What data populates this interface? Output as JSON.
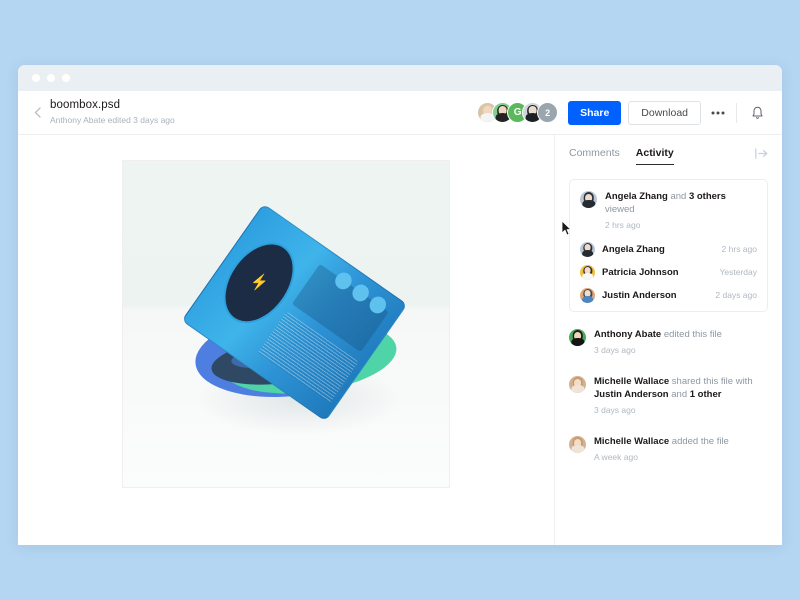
{
  "window": {
    "dots": [
      "close",
      "minimize",
      "maximize"
    ]
  },
  "header": {
    "back_icon": "chevron-left-icon",
    "file_name": "boombox.psd",
    "file_subtitle": "Anthony Abate edited 3 days ago",
    "share_label": "Share",
    "download_label": "Download",
    "more_label": "•••",
    "bell_icon": "bell-icon",
    "avatars": [
      {
        "name": "Avatar 1",
        "type": "photo",
        "bg": "#d8c3a8",
        "hair": "#e3cda6",
        "skin": "#f0d7bd"
      },
      {
        "name": "Avatar 2",
        "type": "photo",
        "bg": "#7fcf8f",
        "hair": "#2a2a2a",
        "skin": "#f0d7bd"
      },
      {
        "name": "Avatar 3",
        "type": "initial",
        "initial": "G",
        "bg": "#5cb85c"
      },
      {
        "name": "Avatar 4",
        "type": "photo",
        "bg": "#cfd6dc",
        "hair": "#20242b",
        "skin": "#eddcc9"
      },
      {
        "name": "Overflow",
        "type": "count",
        "count": "2",
        "bg": "#9aa5ad"
      }
    ]
  },
  "preview": {
    "alt": "boombox.psd preview",
    "artwork": {
      "description": "Translucent blue boombox on blue and teal swirl base",
      "bolt": "⚡"
    }
  },
  "sidebar": {
    "tabs": [
      {
        "label": "Comments",
        "active": false
      },
      {
        "label": "Activity",
        "active": true
      }
    ],
    "collapse_icon": "collapse-panel-icon",
    "viewed_card": {
      "actor": "Angela Zhang",
      "conjunction": "and",
      "others": "3 others",
      "action": "viewed",
      "time": "2 hrs ago",
      "viewers": [
        {
          "name": "Angela Zhang",
          "time": "2 hrs ago",
          "bg": "#b9c6d4",
          "hair": "#2c2f36",
          "skin": "#eddcc9"
        },
        {
          "name": "Patricia Johnson",
          "time": "Yesterday",
          "bg": "#f2c03c",
          "hair": "#2c2f36",
          "skin": "#f3ddc4"
        },
        {
          "name": "Justin Anderson",
          "time": "2 days ago",
          "bg": "#e0a679",
          "hair": "#3c4654",
          "skin": "#f3ddc4"
        }
      ]
    },
    "feed": [
      {
        "actor": "Anthony Abate",
        "action": "edited this file",
        "time": "3 days ago",
        "avatar": {
          "bg": "#4aab5e",
          "hair": "#1b1b1b",
          "skin": "#efd6bb"
        }
      },
      {
        "actor": "Michelle Wallace",
        "action": "shared this file",
        "action2_prefix": "with",
        "target": "Justin Anderson",
        "conjunction": "and",
        "others": "1 other",
        "time": "3 days ago",
        "avatar": {
          "bg": "#d3b193",
          "hair": "#c79a6d",
          "skin": "#f2ddc6"
        }
      },
      {
        "actor": "Michelle Wallace",
        "action": "added the file",
        "time": "A week ago",
        "avatar": {
          "bg": "#d3b193",
          "hair": "#c79a6d",
          "skin": "#f2ddc6"
        }
      }
    ]
  },
  "colors": {
    "page_background": "#b4d6f2",
    "accent": "#0061fe",
    "titlebar": "#eaeff4",
    "text_primary": "#1e1919",
    "text_muted": "#8d98a3",
    "text_faint": "#b0b8c1"
  }
}
